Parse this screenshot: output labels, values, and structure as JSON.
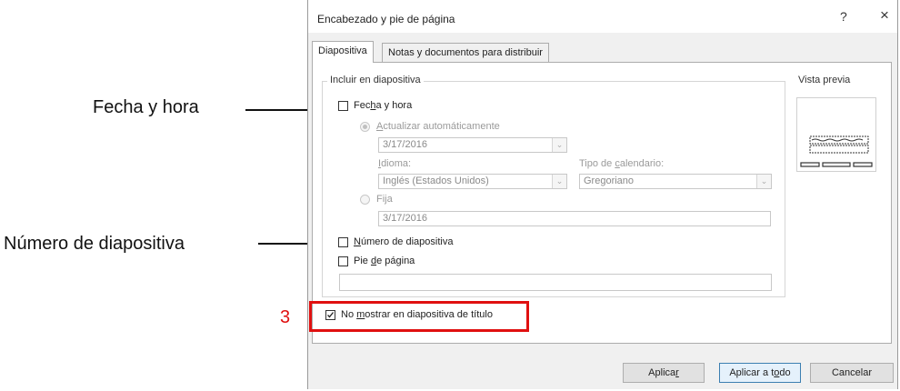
{
  "callouts": {
    "fecha": "Fecha y hora",
    "numero": "Número de diapositiva",
    "step": "3"
  },
  "dialog": {
    "title": "Encabezado y pie de página",
    "help": "?",
    "close": "×",
    "tabs": [
      "Diapositiva",
      "Notas y documentos para distribuir"
    ],
    "include_group": "Incluir en diapositiva",
    "preview_label": "Vista previa",
    "fecha_label": {
      "pre": "Fec",
      "u": "h",
      "post": "a y hora"
    },
    "auto_update": {
      "pre": "",
      "u": "A",
      "post": "ctualizar automáticamente"
    },
    "date_value": "3/17/2016",
    "idioma_label": {
      "pre": "",
      "u": "I",
      "post": "dioma:"
    },
    "idioma_value": "Inglés (Estados Unidos)",
    "calendar_label": {
      "pre": "Tipo de ",
      "u": "c",
      "post": "alendario:"
    },
    "calendar_value": "Gregoriano",
    "fija_label": {
      "pre": "Fi",
      "u": "j",
      "post": "a"
    },
    "fija_value": "3/17/2016",
    "numero_label": {
      "pre": "",
      "u": "N",
      "post": "úmero de diapositiva"
    },
    "pie_label": {
      "pre": "Pie ",
      "u": "d",
      "post": "e página"
    },
    "pie_value": "",
    "no_mostrar_label": {
      "pre": "No ",
      "u": "m",
      "post": "ostrar en diapositiva de título"
    },
    "checks": {
      "fecha": false,
      "numero": false,
      "pie": false,
      "no_mostrar": true
    },
    "buttons": {
      "aplicar": {
        "pre": "Aplica",
        "u": "r",
        "post": ""
      },
      "aplicar_todo": {
        "pre": "Aplicar a t",
        "u": "o",
        "post": "do"
      },
      "cancelar": {
        "pre": "Cancelar",
        "u": "",
        "post": ""
      }
    }
  }
}
